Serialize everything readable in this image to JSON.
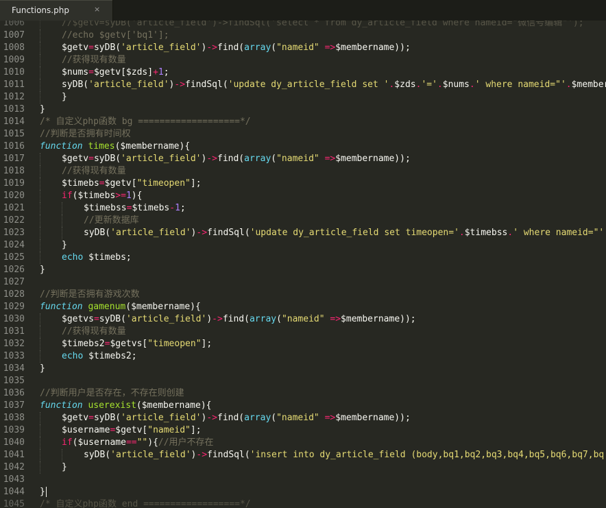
{
  "tab": {
    "title": "Functions.php",
    "close_icon": "×"
  },
  "colors": {
    "background": "#272822",
    "line_number": "#8f908a",
    "comment": "#75715e",
    "keyword": "#66d9ef",
    "function": "#a6e22e",
    "string": "#e6db74",
    "number": "#ae81ff",
    "operator": "#f92672",
    "plain": "#f8f8f2"
  },
  "lines": [
    {
      "n": "1006",
      "indent": 1,
      "faded": true,
      "tokens": [
        [
          "comment",
          "//$getv=syDB('article_field')->findSql('select * from dy_article_field where nameid=\"微信号编辑\"');"
        ]
      ]
    },
    {
      "n": "1007",
      "indent": 1,
      "tokens": [
        [
          "comment",
          "//echo $getv['bq1'];"
        ]
      ]
    },
    {
      "n": "1008",
      "indent": 1,
      "tokens": [
        [
          "plain",
          "$getv"
        ],
        [
          "operator",
          "="
        ],
        [
          "plain",
          "syDB("
        ],
        [
          "string",
          "'article_field'"
        ],
        [
          "plain",
          ")"
        ],
        [
          "operator",
          "->"
        ],
        [
          "plain",
          "find("
        ],
        [
          "builtin",
          "array"
        ],
        [
          "plain",
          "("
        ],
        [
          "string",
          "\"nameid\""
        ],
        [
          "plain",
          " "
        ],
        [
          "operator",
          "=>"
        ],
        [
          "plain",
          "$membername));"
        ]
      ]
    },
    {
      "n": "1009",
      "indent": 1,
      "tokens": [
        [
          "comment",
          "//获得现有数量"
        ]
      ]
    },
    {
      "n": "1010",
      "indent": 1,
      "tokens": [
        [
          "plain",
          "$nums"
        ],
        [
          "operator",
          "="
        ],
        [
          "plain",
          "$getv[$zds]"
        ],
        [
          "operator",
          "+"
        ],
        [
          "number",
          "1"
        ],
        [
          "plain",
          ";"
        ]
      ]
    },
    {
      "n": "1011",
      "indent": 1,
      "tokens": [
        [
          "plain",
          "syDB("
        ],
        [
          "string",
          "'article_field'"
        ],
        [
          "plain",
          ")"
        ],
        [
          "operator",
          "->"
        ],
        [
          "plain",
          "findSql("
        ],
        [
          "string",
          "'update dy_article_field set '"
        ],
        [
          "operator",
          "."
        ],
        [
          "plain",
          "$zds"
        ],
        [
          "operator",
          "."
        ],
        [
          "string",
          "'='"
        ],
        [
          "operator",
          "."
        ],
        [
          "plain",
          "$nums"
        ],
        [
          "operator",
          "."
        ],
        [
          "string",
          "' where nameid=\"'"
        ],
        [
          "operator",
          "."
        ],
        [
          "plain",
          "$membername"
        ]
      ]
    },
    {
      "n": "1012",
      "indent": 1,
      "tokens": [
        [
          "plain",
          "}"
        ]
      ]
    },
    {
      "n": "1013",
      "indent": 0,
      "tokens": [
        [
          "plain",
          "}"
        ]
      ]
    },
    {
      "n": "1014",
      "indent": 0,
      "tokens": [
        [
          "comment",
          "/* 自定义php函数 bg ===================*/"
        ]
      ]
    },
    {
      "n": "1015",
      "indent": 0,
      "tokens": [
        [
          "comment",
          "//判断是否拥有时间权"
        ]
      ]
    },
    {
      "n": "1016",
      "indent": 0,
      "tokens": [
        [
          "keyword",
          "function"
        ],
        [
          "plain",
          " "
        ],
        [
          "function",
          "times"
        ],
        [
          "plain",
          "($membername){"
        ]
      ]
    },
    {
      "n": "1017",
      "indent": 1,
      "tokens": [
        [
          "plain",
          "$getv"
        ],
        [
          "operator",
          "="
        ],
        [
          "plain",
          "syDB("
        ],
        [
          "string",
          "'article_field'"
        ],
        [
          "plain",
          ")"
        ],
        [
          "operator",
          "->"
        ],
        [
          "plain",
          "find("
        ],
        [
          "builtin",
          "array"
        ],
        [
          "plain",
          "("
        ],
        [
          "string",
          "\"nameid\""
        ],
        [
          "plain",
          " "
        ],
        [
          "operator",
          "=>"
        ],
        [
          "plain",
          "$membername));"
        ]
      ]
    },
    {
      "n": "1018",
      "indent": 1,
      "tokens": [
        [
          "comment",
          "//获得现有数量"
        ]
      ]
    },
    {
      "n": "1019",
      "indent": 1,
      "tokens": [
        [
          "plain",
          "$timebs"
        ],
        [
          "operator",
          "="
        ],
        [
          "plain",
          "$getv["
        ],
        [
          "string",
          "\"timeopen\""
        ],
        [
          "plain",
          "];"
        ]
      ]
    },
    {
      "n": "1020",
      "indent": 1,
      "tokens": [
        [
          "operator",
          "if"
        ],
        [
          "plain",
          "($timebs"
        ],
        [
          "operator",
          ">="
        ],
        [
          "number",
          "1"
        ],
        [
          "plain",
          "){"
        ]
      ]
    },
    {
      "n": "1021",
      "indent": 2,
      "tokens": [
        [
          "plain",
          "$timebss"
        ],
        [
          "operator",
          "="
        ],
        [
          "plain",
          "$timebs"
        ],
        [
          "operator",
          "-"
        ],
        [
          "number",
          "1"
        ],
        [
          "plain",
          ";"
        ]
      ]
    },
    {
      "n": "1022",
      "indent": 2,
      "tokens": [
        [
          "comment",
          "//更新数据库"
        ]
      ]
    },
    {
      "n": "1023",
      "indent": 2,
      "tokens": [
        [
          "plain",
          "syDB("
        ],
        [
          "string",
          "'article_field'"
        ],
        [
          "plain",
          ")"
        ],
        [
          "operator",
          "->"
        ],
        [
          "plain",
          "findSql("
        ],
        [
          "string",
          "'update dy_article_field set timeopen='"
        ],
        [
          "operator",
          "."
        ],
        [
          "plain",
          "$timebss"
        ],
        [
          "operator",
          "."
        ],
        [
          "string",
          "' where nameid=\"'"
        ]
      ]
    },
    {
      "n": "1024",
      "indent": 1,
      "tokens": [
        [
          "plain",
          "}"
        ]
      ]
    },
    {
      "n": "1025",
      "indent": 1,
      "tokens": [
        [
          "builtin",
          "echo"
        ],
        [
          "plain",
          " $timebs;"
        ]
      ]
    },
    {
      "n": "1026",
      "indent": 0,
      "tokens": [
        [
          "plain",
          "}"
        ]
      ]
    },
    {
      "n": "1027",
      "indent": 0,
      "tokens": []
    },
    {
      "n": "1028",
      "indent": 0,
      "tokens": [
        [
          "comment",
          "//判断是否拥有游戏次数"
        ]
      ]
    },
    {
      "n": "1029",
      "indent": 0,
      "tokens": [
        [
          "keyword",
          "function"
        ],
        [
          "plain",
          " "
        ],
        [
          "function",
          "gamenum"
        ],
        [
          "plain",
          "($membername){"
        ]
      ]
    },
    {
      "n": "1030",
      "indent": 1,
      "tokens": [
        [
          "plain",
          "$getvs"
        ],
        [
          "operator",
          "="
        ],
        [
          "plain",
          "syDB("
        ],
        [
          "string",
          "'article_field'"
        ],
        [
          "plain",
          ")"
        ],
        [
          "operator",
          "->"
        ],
        [
          "plain",
          "find("
        ],
        [
          "builtin",
          "array"
        ],
        [
          "plain",
          "("
        ],
        [
          "string",
          "\"nameid\""
        ],
        [
          "plain",
          " "
        ],
        [
          "operator",
          "=>"
        ],
        [
          "plain",
          "$membername));"
        ]
      ]
    },
    {
      "n": "1031",
      "indent": 1,
      "tokens": [
        [
          "comment",
          "//获得现有数量"
        ]
      ]
    },
    {
      "n": "1032",
      "indent": 1,
      "tokens": [
        [
          "plain",
          "$timebs2"
        ],
        [
          "operator",
          "="
        ],
        [
          "plain",
          "$getvs["
        ],
        [
          "string",
          "\"timeopen\""
        ],
        [
          "plain",
          "];"
        ]
      ]
    },
    {
      "n": "1033",
      "indent": 1,
      "tokens": [
        [
          "builtin",
          "echo"
        ],
        [
          "plain",
          " $timebs2;"
        ]
      ]
    },
    {
      "n": "1034",
      "indent": 0,
      "tokens": [
        [
          "plain",
          "}"
        ]
      ]
    },
    {
      "n": "1035",
      "indent": 0,
      "tokens": []
    },
    {
      "n": "1036",
      "indent": 0,
      "tokens": [
        [
          "comment",
          "//判断用户是否存在，不存在则创建"
        ]
      ]
    },
    {
      "n": "1037",
      "indent": 0,
      "tokens": [
        [
          "keyword",
          "function"
        ],
        [
          "plain",
          " "
        ],
        [
          "function",
          "userexist"
        ],
        [
          "plain",
          "($membername){"
        ]
      ]
    },
    {
      "n": "1038",
      "indent": 1,
      "tokens": [
        [
          "plain",
          "$getv"
        ],
        [
          "operator",
          "="
        ],
        [
          "plain",
          "syDB("
        ],
        [
          "string",
          "'article_field'"
        ],
        [
          "plain",
          ")"
        ],
        [
          "operator",
          "->"
        ],
        [
          "plain",
          "find("
        ],
        [
          "builtin",
          "array"
        ],
        [
          "plain",
          "("
        ],
        [
          "string",
          "\"nameid\""
        ],
        [
          "plain",
          " "
        ],
        [
          "operator",
          "=>"
        ],
        [
          "plain",
          "$membername));"
        ]
      ]
    },
    {
      "n": "1039",
      "indent": 1,
      "tokens": [
        [
          "plain",
          "$username"
        ],
        [
          "operator",
          "="
        ],
        [
          "plain",
          "$getv["
        ],
        [
          "string",
          "\"nameid\""
        ],
        [
          "plain",
          "];"
        ]
      ]
    },
    {
      "n": "1040",
      "indent": 1,
      "tokens": [
        [
          "operator",
          "if"
        ],
        [
          "plain",
          "($username"
        ],
        [
          "operator",
          "=="
        ],
        [
          "string",
          "\"\""
        ],
        [
          "plain",
          "){"
        ],
        [
          "comment",
          "//用户不存在"
        ]
      ]
    },
    {
      "n": "1041",
      "indent": 2,
      "tokens": [
        [
          "plain",
          "syDB("
        ],
        [
          "string",
          "'article_field'"
        ],
        [
          "plain",
          ")"
        ],
        [
          "operator",
          "->"
        ],
        [
          "plain",
          "findSql("
        ],
        [
          "string",
          "'insert into dy_article_field (body,bq1,bq2,bq3,bq4,bq5,bq6,bq7,bq"
        ]
      ]
    },
    {
      "n": "1042",
      "indent": 1,
      "tokens": [
        [
          "plain",
          "}"
        ]
      ]
    },
    {
      "n": "1043",
      "indent": 0,
      "tokens": []
    },
    {
      "n": "1044",
      "indent": 0,
      "cursor": true,
      "tokens": [
        [
          "plain",
          "}"
        ]
      ]
    },
    {
      "n": "1045",
      "indent": 0,
      "faded": true,
      "tokens": [
        [
          "comment",
          "/* 自定义php函数 end ==================*/"
        ]
      ]
    }
  ]
}
